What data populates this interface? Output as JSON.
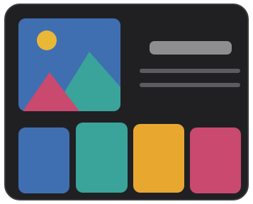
{
  "colors": {
    "frame_background": "#202023",
    "blue": "#3f6fb0",
    "teal": "#3aa39a",
    "yellow": "#e8a830",
    "pink": "#c9496f",
    "sun": "#e9b836",
    "placeholder_title": "#8e8e90",
    "placeholder_line": "#5c5c60"
  },
  "icons": {
    "hero": "image-icon",
    "title": "title-placeholder",
    "lines": "text-line-placeholder",
    "cards": [
      "card-blue",
      "card-teal",
      "card-yellow",
      "card-pink"
    ]
  }
}
